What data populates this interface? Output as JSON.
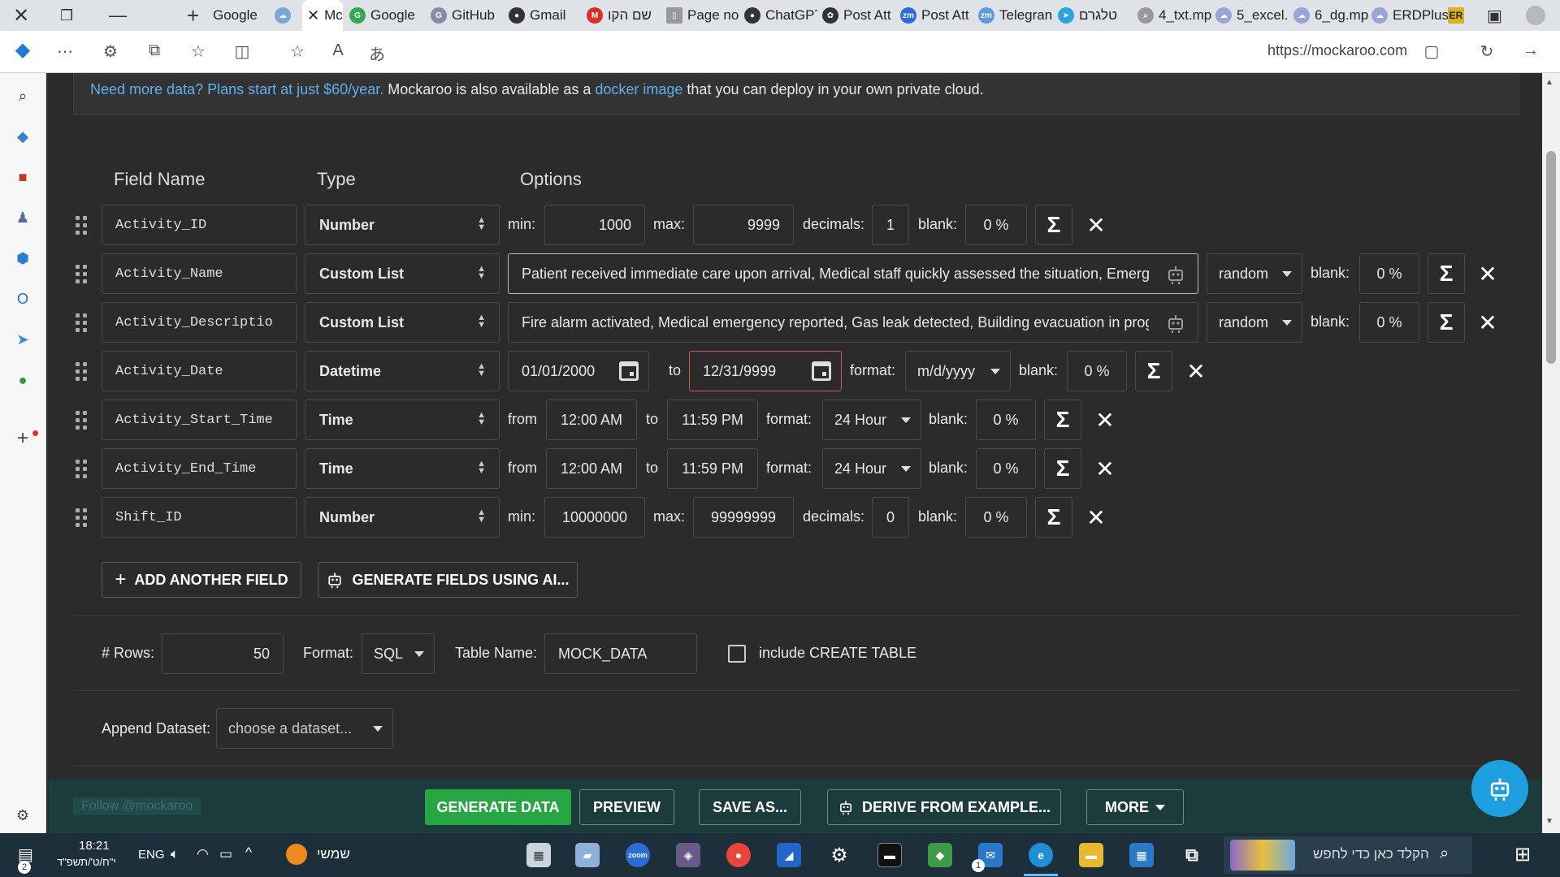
{
  "browser": {
    "tabs": [
      {
        "label": "Google",
        "icon": "google-icon",
        "color": "#4285f4"
      },
      {
        "label": "",
        "icon": "pinned-icon",
        "color": "#7aa7d6"
      },
      {
        "label": "Mc",
        "icon": "mockaroo-icon",
        "color": "#3a8f3a"
      },
      {
        "label": "Google",
        "icon": "google-icon",
        "color": "#34a853"
      },
      {
        "label": "GitHub",
        "icon": "github-icon",
        "color": "#8a8aa8"
      },
      {
        "label": "Gmail",
        "icon": "github-icon",
        "color": "#333333"
      },
      {
        "label": "שם הקו",
        "icon": "gmail-icon",
        "color": "#d93025"
      },
      {
        "label": "Page no",
        "icon": "page-icon",
        "color": "#777777"
      },
      {
        "label": "ChatGPT",
        "icon": "github-icon",
        "color": "#333333"
      },
      {
        "label": "Post Att",
        "icon": "openai-icon",
        "color": "#333333"
      },
      {
        "label": "Post Att",
        "icon": "zoom-icon",
        "color": "#2d6bd6"
      },
      {
        "label": "Telegran",
        "icon": "zoom-icon",
        "color": "#5d9be0"
      },
      {
        "label": "טלגרם",
        "icon": "telegram-icon",
        "color": "#2aa3e0"
      },
      {
        "label": "4_txt.mp",
        "icon": "search-icon",
        "color": "#999999"
      },
      {
        "label": "5_excel.",
        "icon": "cloud-icon",
        "color": "#9aa4d8"
      },
      {
        "label": "6_dg.mp",
        "icon": "cloud-icon",
        "color": "#9aa4d8"
      },
      {
        "label": "ERDPlus",
        "icon": "cloud-icon",
        "color": "#9aa4d8"
      },
      {
        "label": "ER",
        "icon": "erdplus-icon",
        "color": "#e0b020"
      }
    ],
    "url": "https://mockaroo.com"
  },
  "banner": {
    "link1": "Need more data? Plans start at just $60/year.",
    "text1": " Mockaroo is also available as a ",
    "link2": "docker image",
    "text2": " that you can deploy in your own private cloud."
  },
  "headers": {
    "field_name": "Field Name",
    "type": "Type",
    "options": "Options"
  },
  "labels": {
    "min": "min:",
    "max": "max:",
    "decimals": "decimals:",
    "blank": "blank:",
    "to": "to",
    "from": "from",
    "format": "format:"
  },
  "fields": [
    {
      "name": "Activity_ID",
      "type": "Number",
      "min": "1000",
      "max": "9999",
      "decimals": "1",
      "blank": "0 %"
    },
    {
      "name": "Activity_Name",
      "type": "Custom List",
      "values": "Patient received immediate care upon arrival, Medical staff quickly assessed the situation, Emerge",
      "mode": "random",
      "blank": "0 %"
    },
    {
      "name": "Activity_Descriptio",
      "type": "Custom List",
      "values": "Fire alarm activated, Medical emergency reported, Gas leak detected, Building evacuation in progre",
      "mode": "random",
      "blank": "0 %"
    },
    {
      "name": "Activity_Date",
      "type": "Datetime",
      "from": "01/01/2000",
      "to": "12/31/9999",
      "format": "m/d/yyyy",
      "blank": "0 %"
    },
    {
      "name": "Activity_Start_Time",
      "type": "Time",
      "from": "12:00 AM",
      "to": "11:59 PM",
      "format": "24 Hour",
      "blank": "0 %"
    },
    {
      "name": "Activity_End_Time",
      "type": "Time",
      "from": "12:00 AM",
      "to": "11:59 PM",
      "format": "24 Hour",
      "blank": "0 %"
    },
    {
      "name": "Shift_ID",
      "type": "Number",
      "min": "10000000",
      "max": "99999999",
      "decimals": "0",
      "blank": "0 %"
    }
  ],
  "actions": {
    "add_field": "ADD ANOTHER FIELD",
    "generate_ai": "GENERATE FIELDS USING AI..."
  },
  "settings": {
    "rows_label": "# Rows:",
    "rows": "50",
    "format_label": "Format:",
    "format": "SQL",
    "table_label": "Table Name:",
    "table": "MOCK_DATA",
    "create_table": "include CREATE TABLE",
    "append_label": "Append Dataset:",
    "append_placeholder": "choose a dataset..."
  },
  "bottom": {
    "twitter": "Follow @mockaroo",
    "generate": "GENERATE DATA",
    "preview": "PREVIEW",
    "save_as": "SAVE AS...",
    "derive": "DERIVE FROM EXAMPLE...",
    "more": "MORE"
  },
  "taskbar": {
    "time": "18:21",
    "date": "י\"ח/ט'/תשפ\"ד",
    "lang": "ENG",
    "weather": "שמשי",
    "search": "הקלד כאן כדי לחפש",
    "notif_count": "2",
    "mail_count": "1"
  },
  "colors": {
    "green": "#27a744",
    "link": "#5eb0ef",
    "bottom_bar": "#1c3b3c",
    "robot_fab": "#1ea0e0",
    "error": "#d9534f"
  }
}
